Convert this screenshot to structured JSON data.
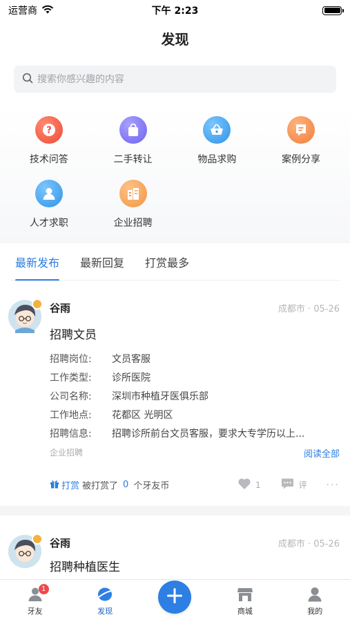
{
  "status_bar": {
    "carrier": "运营商",
    "time": "下午 2:23"
  },
  "nav": {
    "title": "发现"
  },
  "search": {
    "placeholder": "搜索你感兴趣的内容"
  },
  "categories": [
    {
      "label": "技术问答",
      "icon": "question-icon",
      "color": "#f05b47"
    },
    {
      "label": "二手转让",
      "icon": "bag-icon",
      "color": "#7f72f2"
    },
    {
      "label": "物品求购",
      "icon": "basket-icon",
      "color": "#3ea2ec"
    },
    {
      "label": "案例分享",
      "icon": "share-doc-icon",
      "color": "#f2914a"
    },
    {
      "label": "人才求职",
      "icon": "person-icon",
      "color": "#3ea2ec"
    },
    {
      "label": "企业招聘",
      "icon": "building-icon",
      "color": "#f5a04e"
    }
  ],
  "tabs": [
    {
      "label": "最新发布",
      "active": true
    },
    {
      "label": "最新回复",
      "active": false
    },
    {
      "label": "打赏最多",
      "active": false
    }
  ],
  "posts": [
    {
      "author": "谷雨",
      "meta": "成都市 · 05-26",
      "title": "招聘文员",
      "fields": [
        {
          "label": "招聘岗位:",
          "value": "文员客服"
        },
        {
          "label": "工作类型:",
          "value": "诊所医院"
        },
        {
          "label": "公司名称:",
          "value": "深圳市种植牙医俱乐部"
        },
        {
          "label": "工作地点:",
          "value": "花都区 光明区"
        },
        {
          "label": "招聘信息:",
          "value": "招聘诊所前台文员客服，要求大专学历以上..."
        }
      ],
      "tag": "企业招聘",
      "read_all": "阅读全部",
      "reward_label": "打赏",
      "reward_text_before": "被打赏了",
      "reward_count": "0",
      "reward_text_after": "个牙友币",
      "likes": "1",
      "comment_label": "评",
      "more": "···"
    },
    {
      "author": "谷雨",
      "meta": "成都市 · 05-26",
      "title": "招聘种植医生"
    }
  ],
  "tab_bar": [
    {
      "label": "牙友",
      "icon": "user-icon",
      "badge": "1"
    },
    {
      "label": "发现",
      "icon": "discover-icon",
      "active": true
    },
    {
      "label": "",
      "icon": "plus-icon"
    },
    {
      "label": "商城",
      "icon": "shop-icon"
    },
    {
      "label": "我的",
      "icon": "profile-icon"
    }
  ],
  "colors": {
    "accent": "#2b7ce0",
    "badge": "#f04848"
  }
}
